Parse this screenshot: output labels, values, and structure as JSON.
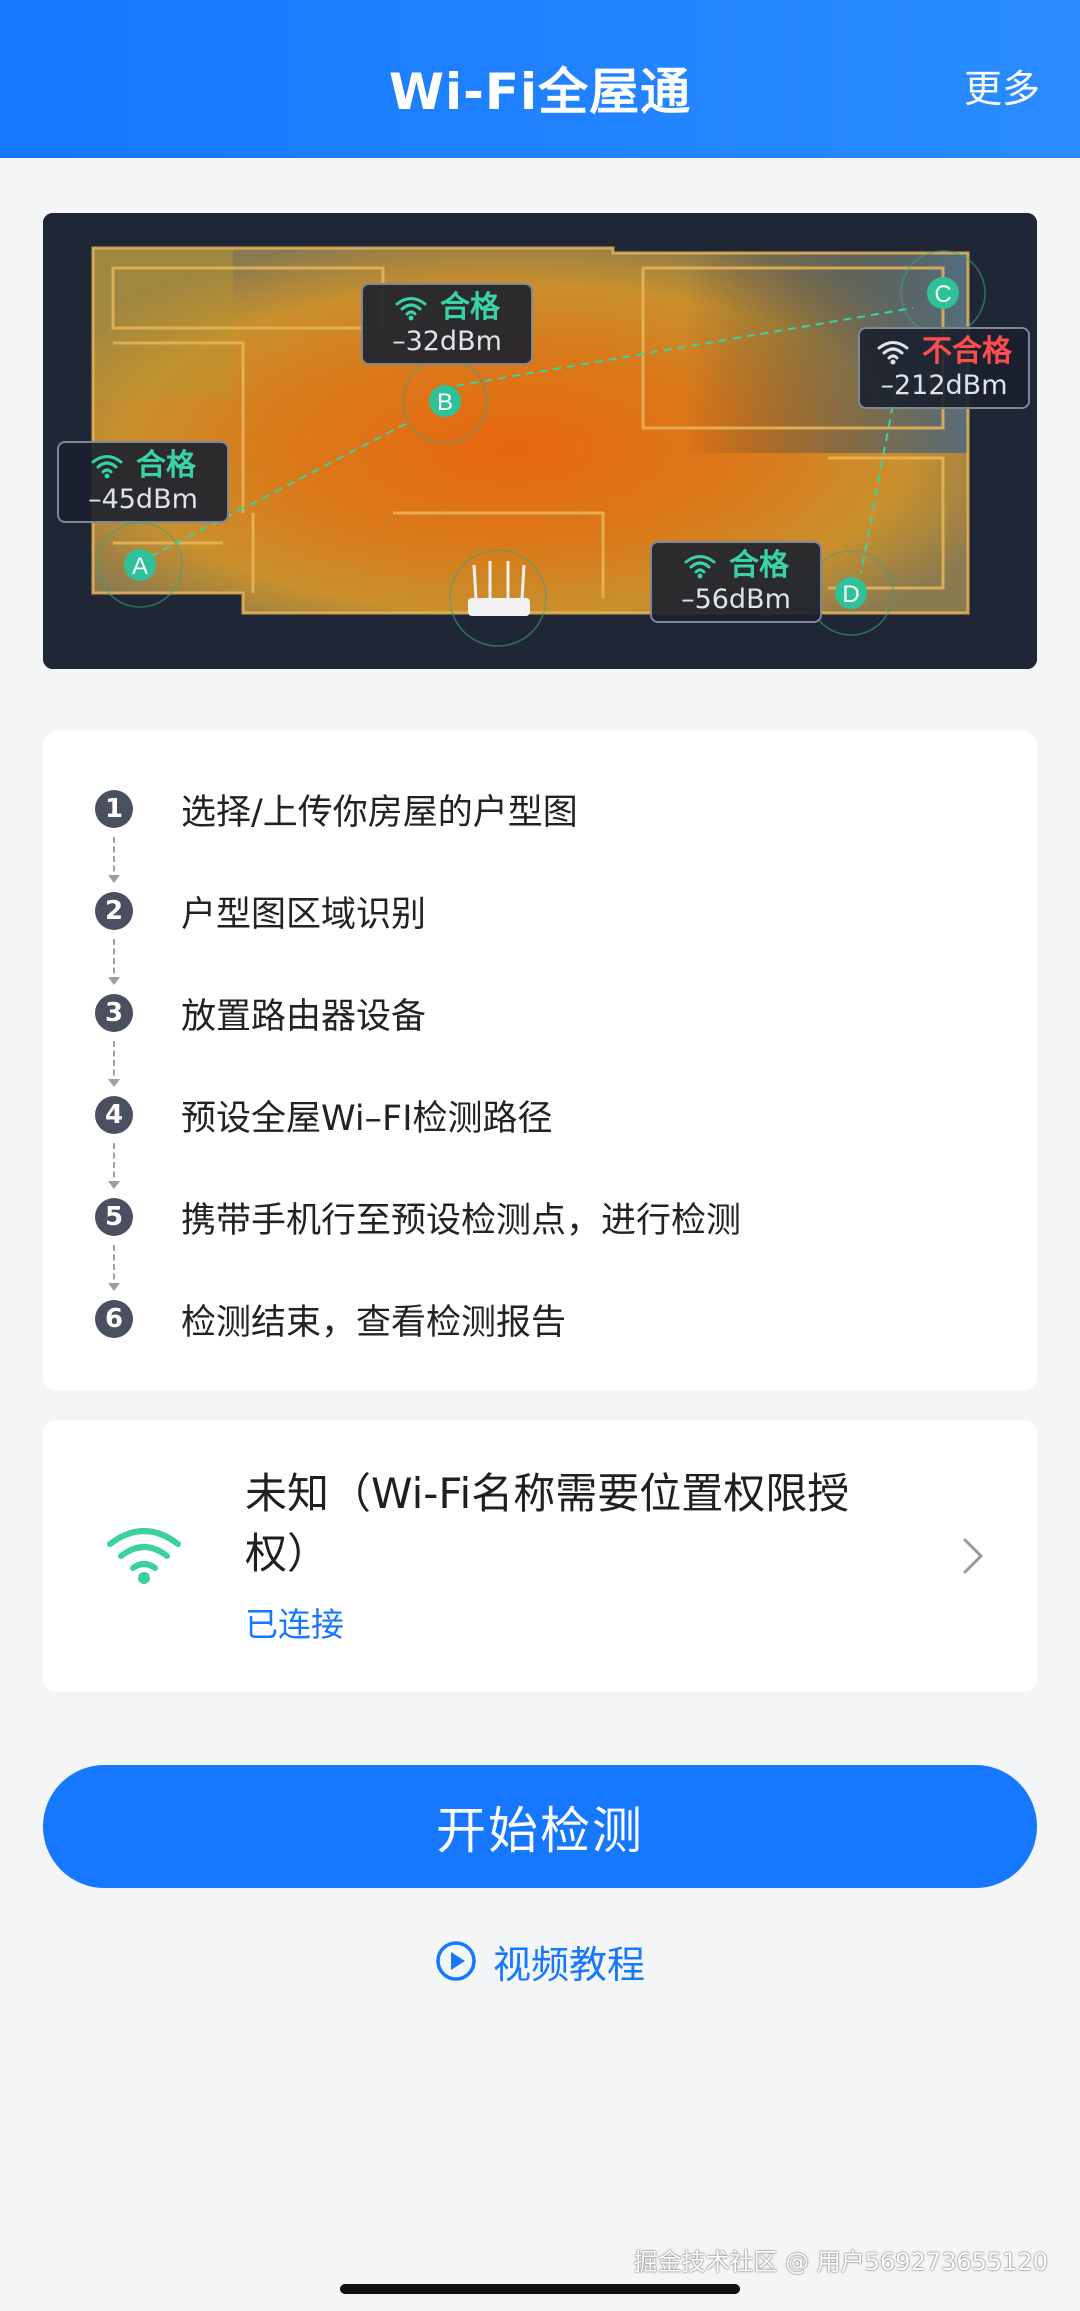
{
  "header": {
    "title": "Wi-Fi全屋通",
    "more_label": "更多"
  },
  "floor_plan": {
    "points": [
      {
        "id": "A",
        "status": "合格",
        "dbm": "–45dBm",
        "qualified": true
      },
      {
        "id": "B",
        "status": "合格",
        "dbm": "–32dBm",
        "qualified": true
      },
      {
        "id": "C",
        "status": "不合格",
        "dbm": "–212dBm",
        "qualified": false
      },
      {
        "id": "D",
        "status": "合格",
        "dbm": "–56dBm",
        "qualified": true
      }
    ]
  },
  "steps": [
    {
      "num": "1",
      "text": "选择/上传你房屋的户型图"
    },
    {
      "num": "2",
      "text": "户型图区域识别"
    },
    {
      "num": "3",
      "text": "放置路由器设备"
    },
    {
      "num": "4",
      "text": "预设全屋Wi–FI检测路径"
    },
    {
      "num": "5",
      "text": "携带手机行至预设检测点，进行检测"
    },
    {
      "num": "6",
      "text": "检测结束，查看检测报告"
    }
  ],
  "wifi": {
    "name": "未知（Wi-Fi名称需要位置权限授权）",
    "status": "已连接",
    "icon": "wifi-icon"
  },
  "start_button_label": "开始检测",
  "video_tutorial_label": "视频教程",
  "watermark": "掘金技术社区 @ 用户569273655120",
  "colors": {
    "primary": "#1677ff",
    "ok": "#39d4a6",
    "fail": "#ff4d4f"
  }
}
